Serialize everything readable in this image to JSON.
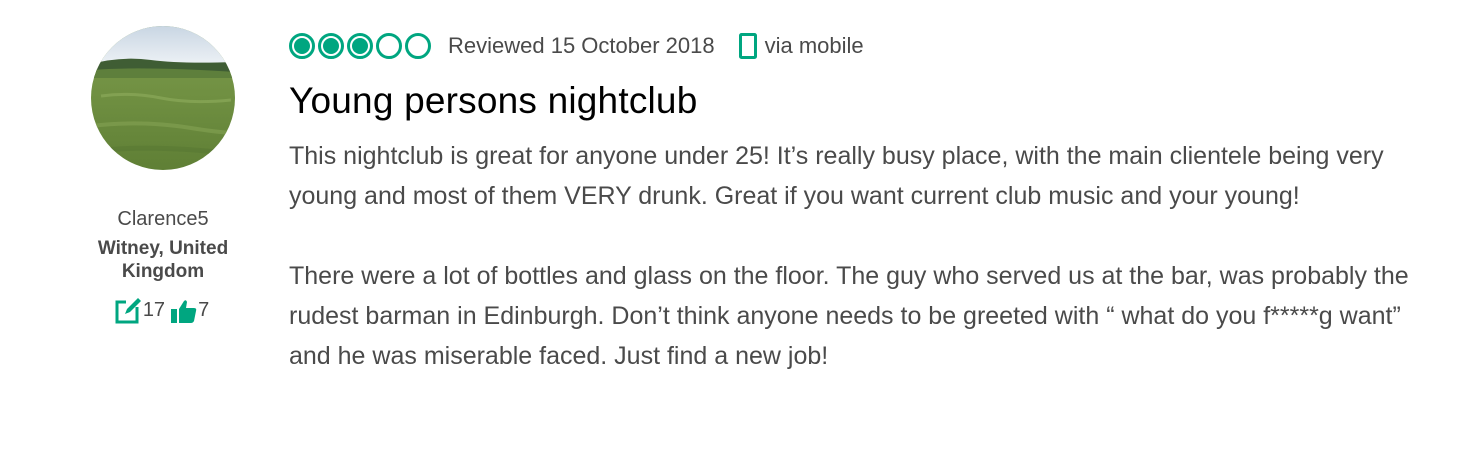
{
  "reviewer": {
    "avatar_icon": "profile-photo-green-field",
    "name": "Clarence5",
    "location": "Witney, United Kingdom",
    "contributions": "17",
    "helpful_votes": "7",
    "contribution_icon": "edit-icon",
    "helpful_icon": "thumbs-up-icon"
  },
  "review": {
    "rating": 3,
    "rating_max": 5,
    "date": "Reviewed 15 October 2018",
    "via": "via mobile",
    "via_icon": "mobile-icon",
    "title": "Young persons nightclub",
    "paragraphs": [
      "This nightclub is great for anyone under 25! It’s really busy place, with the main clientele being very young and most of them VERY drunk. Great if you want current club music and your young!",
      "There were a lot of bottles and glass on the floor. The guy who served us at the bar, was probably the rudest barman in Edinburgh. Don’t think anyone needs to be greeted with “ what do you f*****g want”",
      "and he was miserable faced. Just find a new job!"
    ]
  },
  "colors": {
    "accent": "#00a680",
    "text": "#4a4a4a",
    "title": "#000000"
  }
}
